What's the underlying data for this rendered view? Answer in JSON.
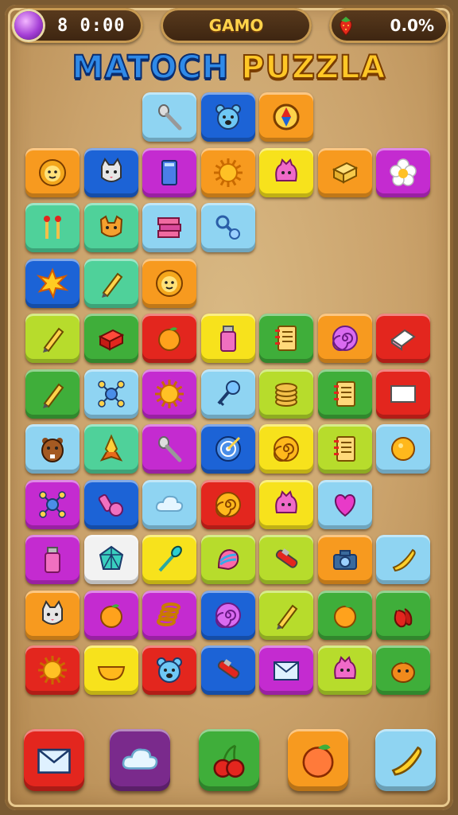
{
  "hud": {
    "timer": "8 0:00",
    "game_label": "GAMO",
    "progress": "0.0%"
  },
  "title": {
    "word1": "MATOCH",
    "word2": "PUZZLA"
  },
  "colors": {
    "orange": "#f79a1f",
    "blue": "#1c63d6",
    "lightblue": "#8fd4f2",
    "magenta": "#c42bd0",
    "yellow": "#f7e21c",
    "green": "#3fae3a",
    "mint": "#4fd19a",
    "lime": "#b7dc2c",
    "red": "#e3261e",
    "white": "#f2f2f2",
    "purple": "#7a2a8c"
  },
  "board": [
    [
      null,
      null,
      {
        "c": "lightblue",
        "i": "spoon"
      },
      {
        "c": "blue",
        "i": "bear"
      },
      {
        "c": "orange",
        "i": "compass"
      },
      null,
      null
    ],
    [
      {
        "c": "orange",
        "i": "lion"
      },
      {
        "c": "blue",
        "i": "cat"
      },
      {
        "c": "magenta",
        "i": "book"
      },
      {
        "c": "orange",
        "i": "sun"
      },
      {
        "c": "yellow",
        "i": "blob"
      },
      {
        "c": "orange",
        "i": "box"
      },
      {
        "c": "magenta",
        "i": "flower"
      }
    ],
    [
      {
        "c": "mint",
        "i": "matches"
      },
      {
        "c": "mint",
        "i": "fox"
      },
      {
        "c": "lightblue",
        "i": "books"
      },
      {
        "c": "lightblue",
        "i": "rattle"
      },
      null,
      null,
      null
    ],
    [
      {
        "c": "blue",
        "i": "burst"
      },
      {
        "c": "mint",
        "i": "pencil"
      },
      {
        "c": "orange",
        "i": "lion"
      },
      null,
      null,
      null,
      null
    ],
    [
      {
        "c": "lime",
        "i": "pencil"
      },
      {
        "c": "green",
        "i": "redbox"
      },
      {
        "c": "red",
        "i": "orange"
      },
      {
        "c": "yellow",
        "i": "bottle"
      },
      {
        "c": "green",
        "i": "notebook"
      },
      {
        "c": "orange",
        "i": "swirl"
      },
      {
        "c": "red",
        "i": "eraser"
      }
    ],
    [
      {
        "c": "green",
        "i": "pencil"
      },
      {
        "c": "lightblue",
        "i": "molecule"
      },
      {
        "c": "magenta",
        "i": "sun"
      },
      {
        "c": "lightblue",
        "i": "key"
      },
      {
        "c": "lime",
        "i": "coins"
      },
      {
        "c": "green",
        "i": "notebook"
      },
      {
        "c": "red",
        "i": "card"
      }
    ],
    [
      {
        "c": "lightblue",
        "i": "beaver"
      },
      {
        "c": "mint",
        "i": "rocket"
      },
      {
        "c": "magenta",
        "i": "spoon"
      },
      {
        "c": "blue",
        "i": "target"
      },
      {
        "c": "yellow",
        "i": "spiral"
      },
      {
        "c": "lime",
        "i": "notebook"
      },
      {
        "c": "lightblue",
        "i": "coin"
      }
    ],
    [
      {
        "c": "magenta",
        "i": "molecule"
      },
      {
        "c": "blue",
        "i": "whistle"
      },
      {
        "c": "lightblue",
        "i": "cloud"
      },
      {
        "c": "red",
        "i": "spiral"
      },
      {
        "c": "yellow",
        "i": "blob"
      },
      {
        "c": "lightblue",
        "i": "heart"
      },
      null
    ],
    [
      {
        "c": "magenta",
        "i": "bottle"
      },
      {
        "c": "white",
        "i": "crystal"
      },
      {
        "c": "yellow",
        "i": "brush"
      },
      {
        "c": "lime",
        "i": "shell"
      },
      {
        "c": "lime",
        "i": "tube"
      },
      {
        "c": "orange",
        "i": "camera"
      },
      {
        "c": "lightblue",
        "i": "banana"
      }
    ],
    [
      {
        "c": "orange",
        "i": "cat"
      },
      {
        "c": "magenta",
        "i": "orange"
      },
      {
        "c": "magenta",
        "i": "spring"
      },
      {
        "c": "blue",
        "i": "swirl"
      },
      {
        "c": "lime",
        "i": "pencil"
      },
      {
        "c": "green",
        "i": "orange"
      },
      {
        "c": "green",
        "i": "pepper"
      }
    ],
    [
      {
        "c": "red",
        "i": "sun"
      },
      {
        "c": "yellow",
        "i": "bowl"
      },
      {
        "c": "red",
        "i": "bear"
      },
      {
        "c": "blue",
        "i": "tube"
      },
      {
        "c": "magenta",
        "i": "envelope"
      },
      {
        "c": "lime",
        "i": "blob"
      },
      {
        "c": "green",
        "i": "pumpkin"
      }
    ]
  ],
  "bottom_buttons": [
    {
      "c": "red",
      "i": "envelope",
      "name": "mail-button"
    },
    {
      "c": "purple",
      "i": "cloud",
      "name": "cloud-button"
    },
    {
      "c": "green",
      "i": "cherry",
      "name": "cherry-button"
    },
    {
      "c": "orange",
      "i": "peach",
      "name": "peach-button"
    },
    {
      "c": "lightblue",
      "i": "banana",
      "name": "banana-button"
    }
  ]
}
